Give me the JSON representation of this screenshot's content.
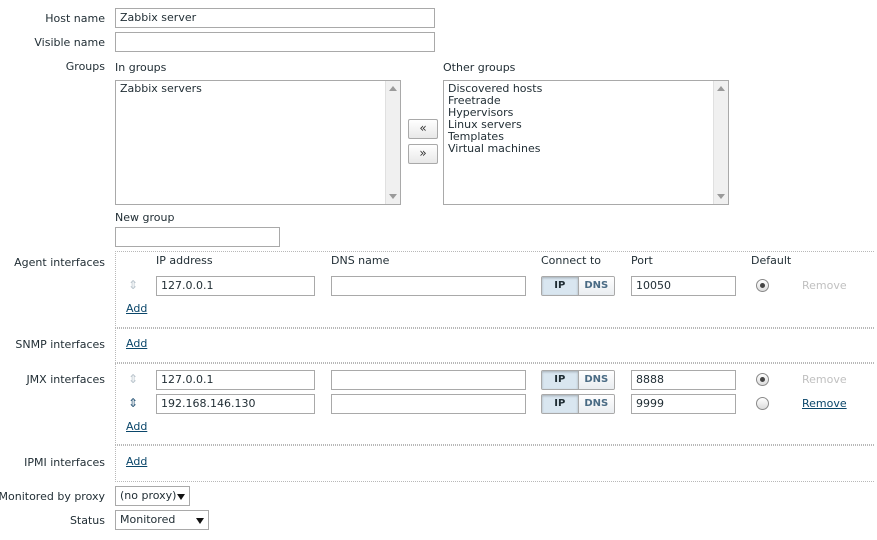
{
  "labels": {
    "host_name": "Host name",
    "visible_name": "Visible name",
    "groups": "Groups",
    "in_groups": "In groups",
    "other_groups": "Other groups",
    "new_group": "New group",
    "agent_interfaces": "Agent interfaces",
    "snmp_interfaces": "SNMP interfaces",
    "jmx_interfaces": "JMX interfaces",
    "ipmi_interfaces": "IPMI interfaces",
    "monitored_by_proxy": "Monitored by proxy",
    "status": "Status"
  },
  "fields": {
    "host_name": "Zabbix server",
    "visible_name": "",
    "new_group": ""
  },
  "groups": {
    "in_groups": [
      "Zabbix servers"
    ],
    "other_groups": [
      "Discovered hosts",
      "Freetrade",
      "Hypervisors",
      "Linux servers",
      "Templates",
      "Virtual machines"
    ],
    "move_left": "«",
    "move_right": "»"
  },
  "interface_headers": {
    "ip_address": "IP address",
    "dns_name": "DNS name",
    "connect_to": "Connect to",
    "port": "Port",
    "default": "Default"
  },
  "connect": {
    "ip": "IP",
    "dns": "DNS"
  },
  "add_label": "Add",
  "remove_label": "Remove",
  "agent_interfaces": [
    {
      "ip": "127.0.0.1",
      "dns": "",
      "connect": "IP",
      "port": "10050",
      "default": true,
      "removable": false
    }
  ],
  "jmx_interfaces": [
    {
      "ip": "127.0.0.1",
      "dns": "",
      "connect": "IP",
      "port": "8888",
      "default": true,
      "removable": false
    },
    {
      "ip": "192.168.146.130",
      "dns": "",
      "connect": "IP",
      "port": "9999",
      "default": false,
      "removable": true
    }
  ],
  "proxy": {
    "selected": "(no proxy)"
  },
  "status": {
    "selected": "Monitored"
  },
  "icons": {
    "drag_handle": "drag-handle-icon",
    "dropdown": "chevron-down-icon"
  }
}
